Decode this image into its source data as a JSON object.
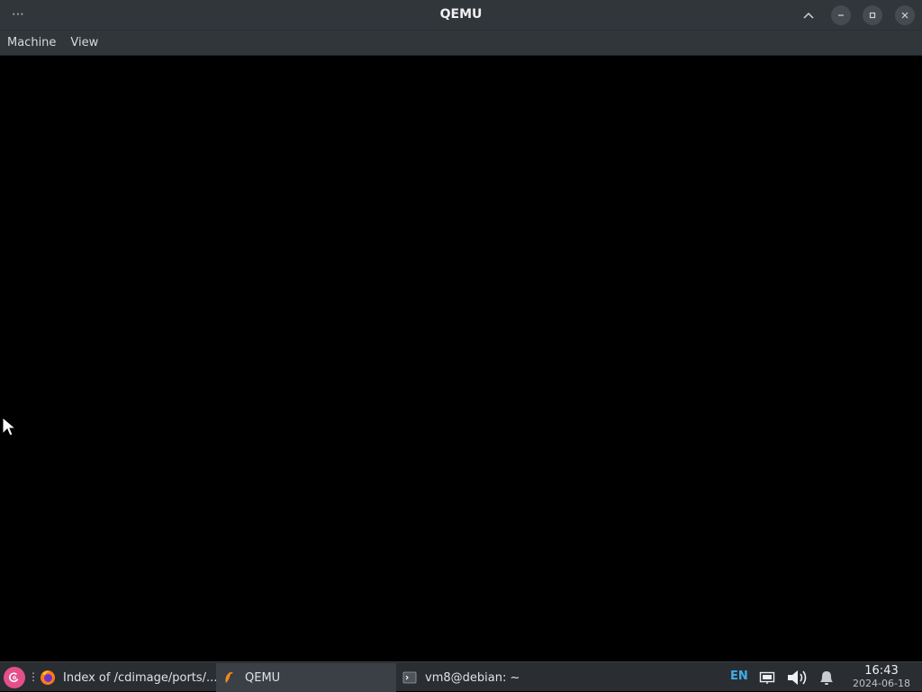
{
  "window": {
    "title": "QEMU",
    "menu_icon": "dots-menu-icon",
    "controls": [
      "keep-above-icon",
      "minimize-icon",
      "restore-icon",
      "close-icon"
    ]
  },
  "menubar": {
    "items": [
      {
        "label": "Machine"
      },
      {
        "label": "View"
      }
    ]
  },
  "vm_screen": {
    "background": "#000000",
    "cursor_icon": "mouse-pointer-icon"
  },
  "taskbar": {
    "start_icon": "debian-start-icon",
    "separator": "⋮",
    "tasks": [
      {
        "label": "Index of /cdimage/ports/...",
        "icon": "firefox-icon",
        "active": false
      },
      {
        "label": "QEMU",
        "icon": "qemu-icon",
        "active": true
      },
      {
        "label": "vm8@debian: ~",
        "icon": "terminal-icon",
        "active": false
      }
    ],
    "tray": {
      "keyboard_layout": "EN",
      "icons": [
        "network-icon",
        "volume-icon",
        "notifications-icon"
      ]
    },
    "clock": {
      "time": "16:43",
      "date": "2024-06-18"
    }
  },
  "colors": {
    "titlebar": "#31363b",
    "taskbar": "#2a2e32",
    "accent": "#3daee9",
    "start": "#e3508a"
  }
}
